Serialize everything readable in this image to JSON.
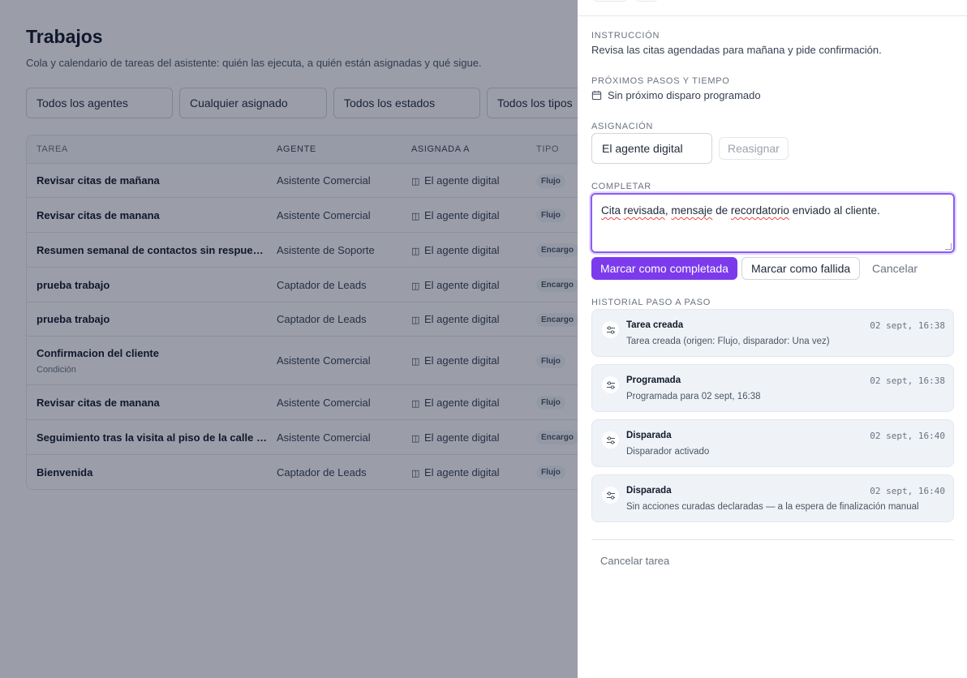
{
  "page": {
    "title": "Trabajos",
    "subtitle": "Cola y calendario de tareas del asistente: quién las ejecuta, a quién están asignadas y qué sigue."
  },
  "filters": [
    "Todos los agentes",
    "Cualquier asignado",
    "Todos los estados",
    "Todos los tipos"
  ],
  "table": {
    "headers": {
      "task": "TAREA",
      "agent": "AGENTE",
      "assigned": "ASIGNADA A",
      "type": "TIPO"
    },
    "rows": [
      {
        "task": "Revisar citas de mañana",
        "sub": "",
        "agent": "Asistente Comercial",
        "assigned": "El agente digital",
        "type": "Flujo"
      },
      {
        "task": "Revisar citas de manana",
        "sub": "",
        "agent": "Asistente Comercial",
        "assigned": "El agente digital",
        "type": "Flujo"
      },
      {
        "task": "Resumen semanal de contactos sin respuesta",
        "sub": "",
        "agent": "Asistente de Soporte",
        "assigned": "El agente digital",
        "type": "Encargo"
      },
      {
        "task": "prueba trabajo",
        "sub": "",
        "agent": "Captador de Leads",
        "assigned": "El agente digital",
        "type": "Encargo"
      },
      {
        "task": "prueba trabajo",
        "sub": "",
        "agent": "Captador de Leads",
        "assigned": "El agente digital",
        "type": "Encargo"
      },
      {
        "task": "Confirmacion del cliente",
        "sub": "Condición",
        "agent": "Asistente Comercial",
        "assigned": "El agente digital",
        "type": "Flujo"
      },
      {
        "task": "Revisar citas de manana",
        "sub": "",
        "agent": "Asistente Comercial",
        "assigned": "El agente digital",
        "type": "Flujo"
      },
      {
        "task": "Seguimiento tras la visita al piso de la calle Ma...",
        "sub": "",
        "agent": "Asistente Comercial",
        "assigned": "El agente digital",
        "type": "Encargo"
      },
      {
        "task": "Bienvenida",
        "sub": "",
        "agent": "Captador de Leads",
        "assigned": "El agente digital",
        "type": "Flujo"
      }
    ]
  },
  "panel": {
    "instruction": {
      "label": "INSTRUCCIÓN",
      "text": "Revisa las citas agendadas para mañana y pide confirmación."
    },
    "next_steps": {
      "label": "PRÓXIMOS PASOS Y TIEMPO",
      "text": "Sin próximo disparo programado"
    },
    "assignment": {
      "label": "ASIGNACIÓN",
      "value": "El agente digital",
      "reassign_label": "Reasignar"
    },
    "complete": {
      "label": "COMPLETAR",
      "text_parts": [
        "Cita",
        " ",
        "revisada",
        ", ",
        "mensaje",
        " de ",
        "recordatorio",
        " enviado al cliente."
      ],
      "primary_label": "Marcar como completada",
      "fail_label": "Marcar como fallida",
      "cancel_label": "Cancelar"
    },
    "history": {
      "label": "HISTORIAL PASO A PASO",
      "items": [
        {
          "title": "Tarea creada",
          "desc": "Tarea creada (origen: Flujo, disparador: Una vez)",
          "time": "02 sept, 16:38"
        },
        {
          "title": "Programada",
          "desc": "Programada para 02 sept, 16:38",
          "time": "02 sept, 16:38"
        },
        {
          "title": "Disparada",
          "desc": "Disparador activado",
          "time": "02 sept, 16:40"
        },
        {
          "title": "Disparada",
          "desc": "Sin acciones curadas declaradas — a la espera de finalización manual",
          "time": "02 sept, 16:40"
        }
      ]
    },
    "cancel_task_label": "Cancelar tarea"
  },
  "colors": {
    "accent": "#7c3aed",
    "focus_ring": "#8b5cf6",
    "overlay": "#111831"
  }
}
